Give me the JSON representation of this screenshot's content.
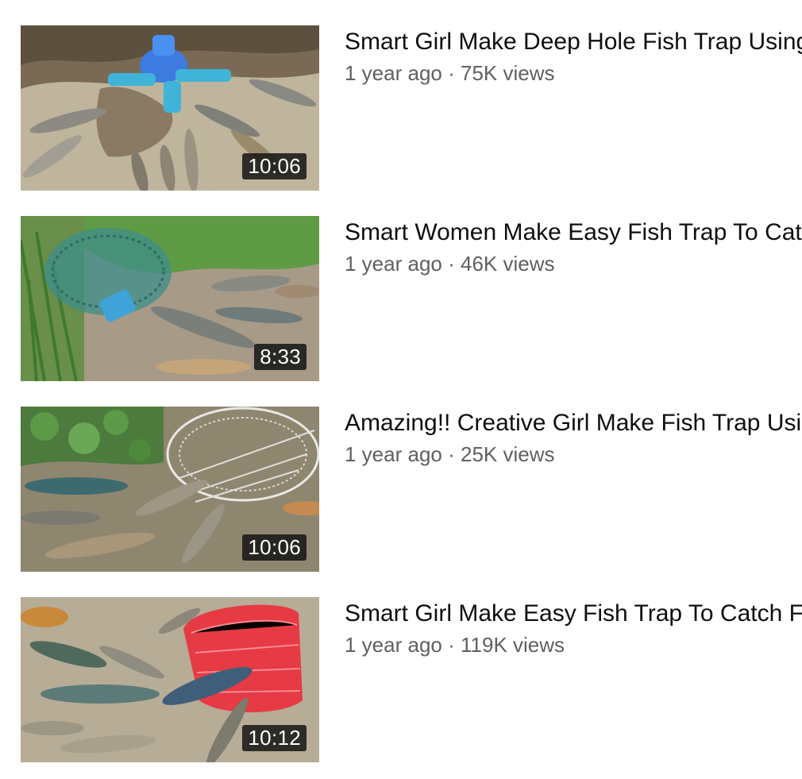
{
  "videos": [
    {
      "title": "Smart Girl Make Deep Hole Fish Trap Using Plastic Pipe",
      "age": "1 year ago",
      "views": "75K views",
      "separator": "·",
      "duration": "10:06"
    },
    {
      "title": "Smart Women Make Easy Fish Trap To Catch Fish",
      "age": "1 year ago",
      "views": "46K views",
      "separator": "·",
      "duration": "8:33"
    },
    {
      "title": "Amazing!! Creative Girl Make Fish Trap Using",
      "age": "1 year ago",
      "views": "25K views",
      "separator": "·",
      "duration": "10:06"
    },
    {
      "title": "Smart Girl Make Easy Fish Trap To Catch Fish",
      "age": "1 year ago",
      "views": "119K views",
      "separator": "·",
      "duration": "10:12"
    }
  ],
  "colors": {
    "text_primary": "#0f0f0f",
    "text_secondary": "#606060",
    "duration_bg": "#141414"
  }
}
